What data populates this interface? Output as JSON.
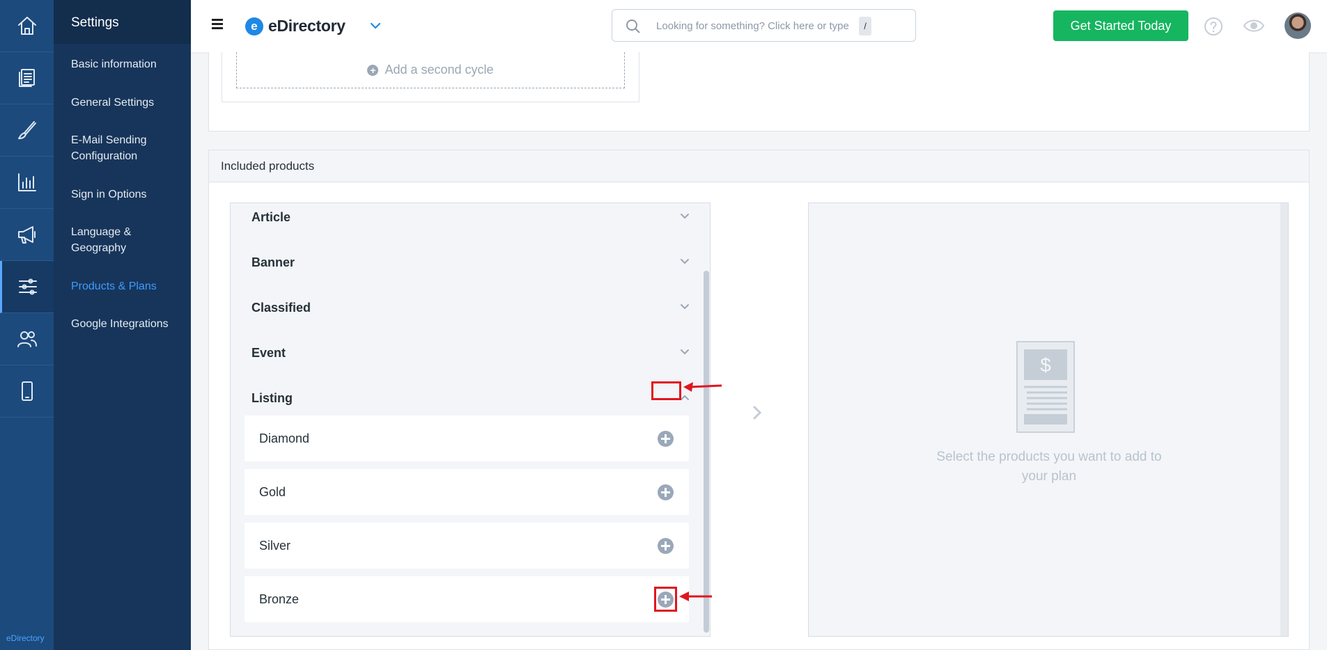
{
  "rail": {
    "items": [
      {
        "icon": "home-icon"
      },
      {
        "icon": "content-icon"
      },
      {
        "icon": "brush-icon"
      },
      {
        "icon": "reports-icon"
      },
      {
        "icon": "megaphone-icon"
      },
      {
        "icon": "settings-sliders-icon",
        "active": true
      },
      {
        "icon": "users-icon"
      },
      {
        "icon": "mobile-icon"
      }
    ],
    "brand": "eDirectory"
  },
  "subnav": {
    "title": "Settings",
    "items": [
      {
        "label": "Basic information"
      },
      {
        "label": "General Settings"
      },
      {
        "label": "E-Mail Sending Configuration"
      },
      {
        "label": "Sign in Options"
      },
      {
        "label": "Language & Geography"
      },
      {
        "label": "Products & Plans",
        "active": true
      },
      {
        "label": "Google Integrations"
      }
    ]
  },
  "topbar": {
    "logo_letter": "e",
    "logo_text": "eDirectory",
    "search_placeholder": "Looking for something? Click here or type",
    "search_shortcut": "/",
    "cta_label": "Get Started Today"
  },
  "cycle": {
    "add_label": "Add a second cycle"
  },
  "included": {
    "title": "Included products",
    "categories": [
      {
        "label": "Article",
        "expanded": false
      },
      {
        "label": "Banner",
        "expanded": false
      },
      {
        "label": "Classified",
        "expanded": false
      },
      {
        "label": "Event",
        "expanded": false
      },
      {
        "label": "Listing",
        "expanded": true
      }
    ],
    "listing_levels": [
      {
        "label": "Diamond"
      },
      {
        "label": "Gold"
      },
      {
        "label": "Silver"
      },
      {
        "label": "Bronze"
      }
    ],
    "empty_message": "Select the products you want to add to your plan",
    "empty_icon": "price-document-icon"
  },
  "colors": {
    "rail": "#1c4a7c",
    "subnav": "#17355a",
    "accent": "#3d9cff",
    "cta": "#16b560",
    "annotation": "#e0161e"
  }
}
